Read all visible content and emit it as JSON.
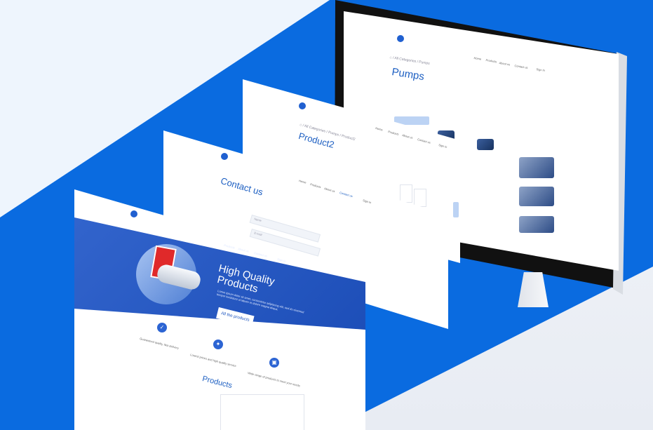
{
  "colors": {
    "brand": "#0a6be0",
    "accent": "#1d5fc2",
    "hero": "#2a5cc6"
  },
  "pumps_page": {
    "title": "Pumps",
    "breadcrumb": "⌂ / All Categories / Pumps",
    "nav": [
      "Home",
      "Products",
      "About us",
      "Contact us",
      "Sign In"
    ]
  },
  "product2_page": {
    "title": "Product2",
    "breadcrumb": "⌂ / All Categories / Pumps / Product2",
    "nav": [
      "Home",
      "Products",
      "About us",
      "Contact us",
      "Sign In"
    ]
  },
  "contact_page": {
    "title": "Contact us",
    "nav": [
      "Home",
      "Products",
      "About us",
      "Contact us",
      "Sign In"
    ],
    "fields": [
      "Name",
      "E-mail",
      "Company, Website, Number"
    ]
  },
  "home_page": {
    "nav": [
      "Home",
      "Products",
      "About us",
      "Contact us",
      "Sign In"
    ],
    "hero_title_1": "High Quality",
    "hero_title_2": "Products",
    "hero_text": "Lorem ipsum dolor sit amet, consectetur adipiscing elit, sed do eiusmod tempor incididunt ut labore et dolore magna aliqua.",
    "hero_button": "All the products",
    "features": [
      "Guaranteed quality, fast delivery",
      "Lowest prices and high quality service",
      "Wide range of products to meet your needs"
    ],
    "products_heading": "Products"
  }
}
